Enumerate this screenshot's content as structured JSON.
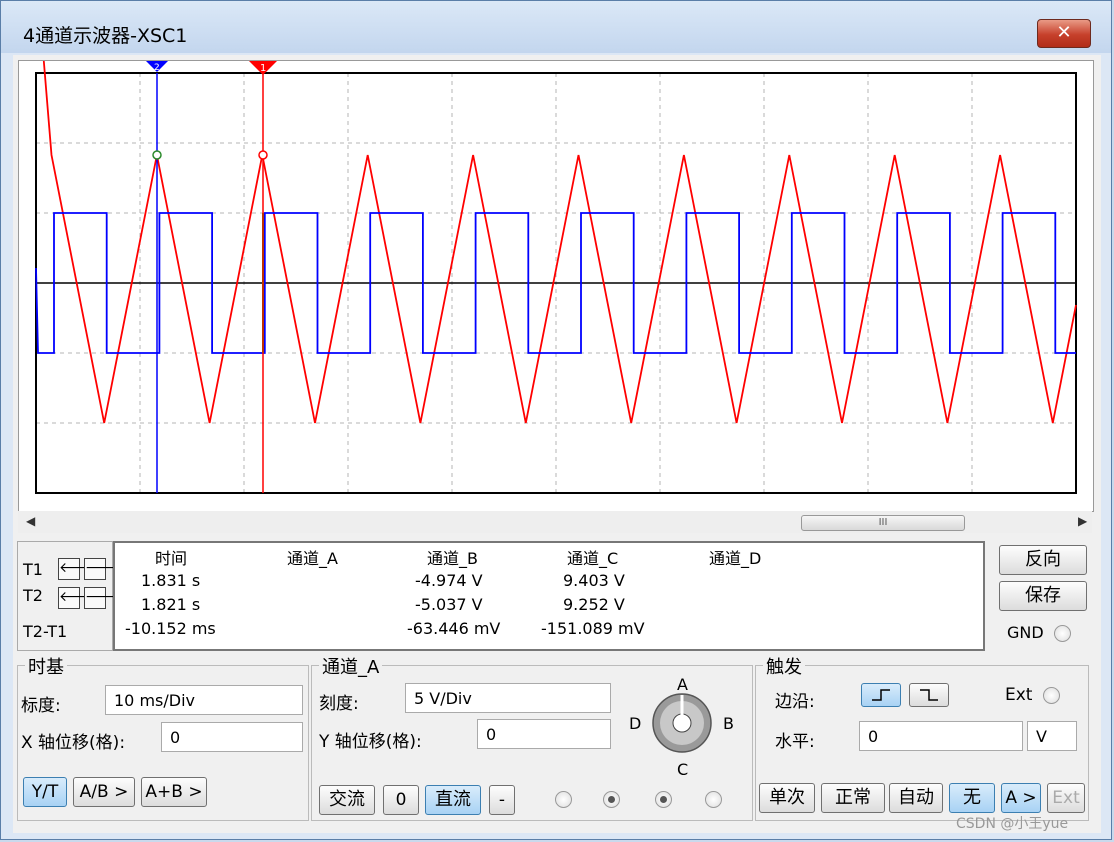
{
  "window": {
    "title": "4通道示波器-XSC1",
    "close": "✕"
  },
  "scope": {
    "cursor1_label": "1",
    "cursor2_label": "2",
    "scroll_left": "◀",
    "scroll_right": "▶",
    "scroll_thumb": "III",
    "colors": {
      "channel_A": "#ff0000",
      "channel_B": "#0000ff",
      "ground": "#000000",
      "cursor1": "#ff0000",
      "cursor2": "#0000ff"
    }
  },
  "cursors": {
    "t1": "T1",
    "t2": "T2",
    "t2_t1": "T2-T1",
    "left_arrow": "🡐",
    "right_arrow": "🡒"
  },
  "readout": {
    "headers": [
      "时间",
      "通道_A",
      "通道_B",
      "通道_C",
      "通道_D"
    ],
    "rows": [
      [
        "1.831 s",
        "",
        "-4.974 V",
        "9.403 V",
        ""
      ],
      [
        "1.821 s",
        "",
        "-5.037 V",
        "9.252 V",
        ""
      ],
      [
        "-10.152 ms",
        "",
        "-63.446 mV",
        "-151.089 mV",
        ""
      ]
    ]
  },
  "side": {
    "reverse": "反向",
    "save": "保存",
    "gnd": "GND"
  },
  "timebase": {
    "title": "时基",
    "scale_label": "标度:",
    "scale_value": "10 ms/Div",
    "xpos_label": "X 轴位移(格):",
    "xpos_value": "0",
    "yt": "Y/T",
    "ab": "A/B >",
    "aplusb": "A+B >"
  },
  "channel": {
    "title": "通道_A",
    "scale_label": "刻度:",
    "scale_value": "5  V/Div",
    "ypos_label": "Y 轴位移(格):",
    "ypos_value": "0",
    "ac": "交流",
    "zero": "0",
    "dc": "直流",
    "minus": "-",
    "knob_labels": {
      "a": "A",
      "b": "B",
      "c": "C",
      "d": "D"
    }
  },
  "trigger": {
    "title": "触发",
    "edge_label": "边沿:",
    "ext_label": "Ext",
    "level_label": "水平:",
    "level_value": "0",
    "level_unit": "V",
    "single": "单次",
    "normal": "正常",
    "auto": "自动",
    "none": "无",
    "a_src": "A >",
    "ext_src": "Ext"
  },
  "watermark": "CSDN @小王yue"
}
